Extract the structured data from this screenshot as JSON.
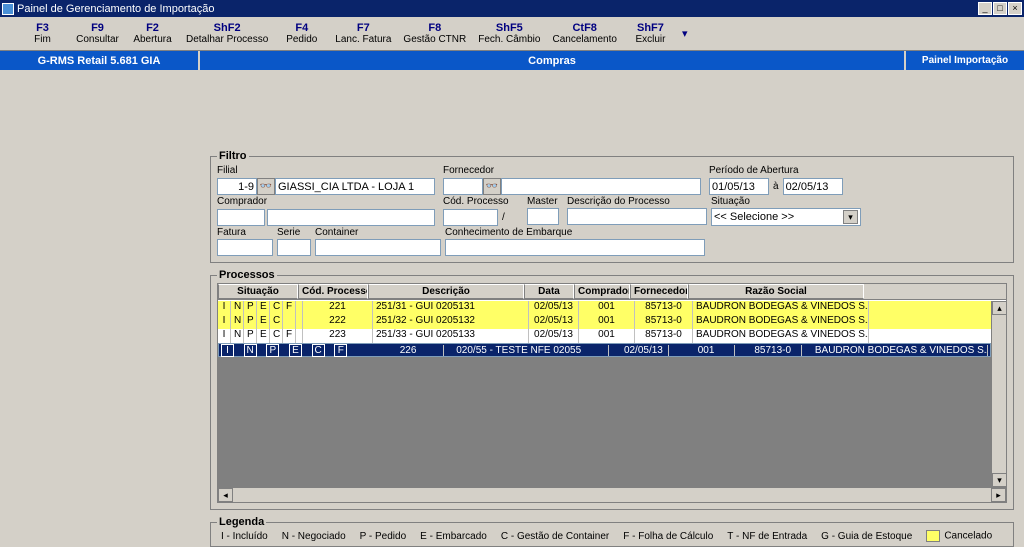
{
  "titlebar": {
    "text": "Painel de Gerenciamento de Importação"
  },
  "toolbar": [
    {
      "key": "F3",
      "label": "Fim"
    },
    {
      "key": "F9",
      "label": "Consultar"
    },
    {
      "key": "F2",
      "label": "Abertura"
    },
    {
      "key": "ShF2",
      "label": "Detalhar Processo"
    },
    {
      "key": "F4",
      "label": "Pedido"
    },
    {
      "key": "F7",
      "label": "Lanc. Fatura"
    },
    {
      "key": "F8",
      "label": "Gestão CTNR"
    },
    {
      "key": "ShF5",
      "label": "Fech. Câmbio"
    },
    {
      "key": "CtF8",
      "label": "Cancelamento"
    },
    {
      "key": "ShF7",
      "label": "Excluir"
    }
  ],
  "bluebar": {
    "left": "G-RMS Retail 5.681 GIA",
    "center": "Compras",
    "right": "Painel Importação"
  },
  "filter": {
    "legend": "Filtro",
    "filial_label": "Filial",
    "filial_code": "1-9",
    "filial_name": "GIASSI_CIA LTDA - LOJA 1",
    "fornecedor_label": "Fornecedor",
    "periodo_label": "Período de Abertura",
    "periodo_from": "01/05/13",
    "periodo_sep": "à",
    "periodo_to": "02/05/13",
    "comprador_label": "Comprador",
    "codproc_label": "Cód. Processo",
    "codproc_sep": "/",
    "master_label": "Master",
    "descproc_label": "Descrição do Processo",
    "situacao_label": "Situação",
    "situacao_value": "<< Selecione >>",
    "fatura_label": "Fatura",
    "serie_label": "Serie",
    "container_label": "Container",
    "conhecimento_label": "Conhecimento de Embarque"
  },
  "processos": {
    "legend": "Processos",
    "headers": {
      "situacao": "Situação",
      "cod": "Cód. Processo",
      "desc": "Descrição",
      "data": "Data",
      "comprador": "Comprador",
      "fornecedor": "Fornecedor",
      "razao": "Razão Social"
    },
    "rows": [
      {
        "sit": [
          "I",
          "N",
          "P",
          "E",
          "C",
          "F"
        ],
        "cod": "221",
        "desc": "251/31 - GUI 0205131",
        "data": "02/05/13",
        "comp": "001",
        "forn": "85713-0",
        "raz": "BAUDRON BODEGAS & VINEDOS S.A",
        "cls": "yellow"
      },
      {
        "sit": [
          "I",
          "N",
          "P",
          "E",
          "C",
          ""
        ],
        "cod": "222",
        "desc": "251/32 - GUI 0205132",
        "data": "02/05/13",
        "comp": "001",
        "forn": "85713-0",
        "raz": "BAUDRON BODEGAS & VINEDOS S.A",
        "cls": "yellow"
      },
      {
        "sit": [
          "I",
          "N",
          "P",
          "E",
          "C",
          "F"
        ],
        "cod": "223",
        "desc": "251/33 - GUI 0205133",
        "data": "02/05/13",
        "comp": "001",
        "forn": "85713-0",
        "raz": "BAUDRON BODEGAS & VINEDOS S.A",
        "cls": "white"
      },
      {
        "sit": [
          "I",
          "N",
          "P",
          "E",
          "C",
          "F"
        ],
        "cod": "226",
        "desc": "020/55 - TESTE NFE 02055",
        "data": "02/05/13",
        "comp": "001",
        "forn": "85713-0",
        "raz": "BAUDRON BODEGAS & VINEDOS S.A",
        "cls": "sel"
      }
    ]
  },
  "legenda": {
    "legend": "Legenda",
    "i": "I - Incluído",
    "n": "N - Negociado",
    "p": "P - Pedido",
    "e": "E - Embarcado",
    "c": "C - Gestão de Container",
    "f": "F - Folha de Cálculo",
    "t": "T - NF de Entrada",
    "g": "G - Guia de Estoque",
    "cancelado": "Cancelado"
  }
}
